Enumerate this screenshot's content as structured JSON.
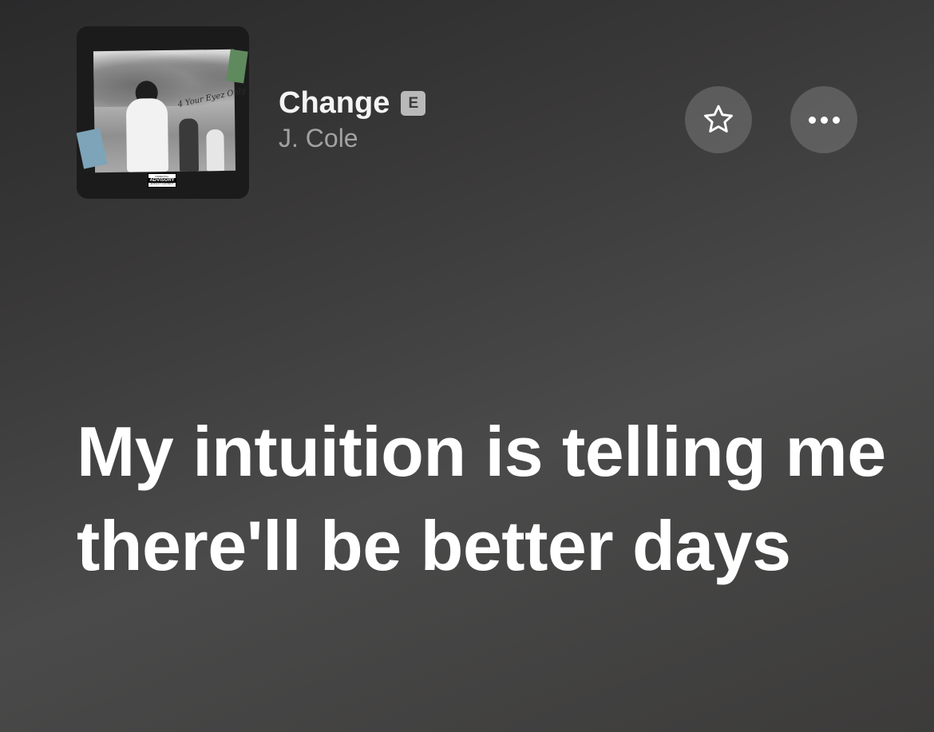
{
  "now_playing": {
    "artwork": {
      "album_script": "4 Your Eyez Only",
      "advisory": {
        "top": "PARENTAL",
        "middle": "ADVISORY",
        "bottom": "EXPLICIT CONTENT"
      }
    },
    "title": "Change",
    "explicit_badge": "E",
    "artist": "J. Cole",
    "favorite_icon": "star-outline-icon",
    "more_icon": "ellipsis-icon"
  },
  "lyrics": {
    "current_line": "My intuition is telling me there'll be better days"
  },
  "colors": {
    "background": "#3a3939",
    "title": "#f4f4f4",
    "artist": "#a2a2a2",
    "button_bg": "#787878",
    "lyric": "#ffffff"
  }
}
